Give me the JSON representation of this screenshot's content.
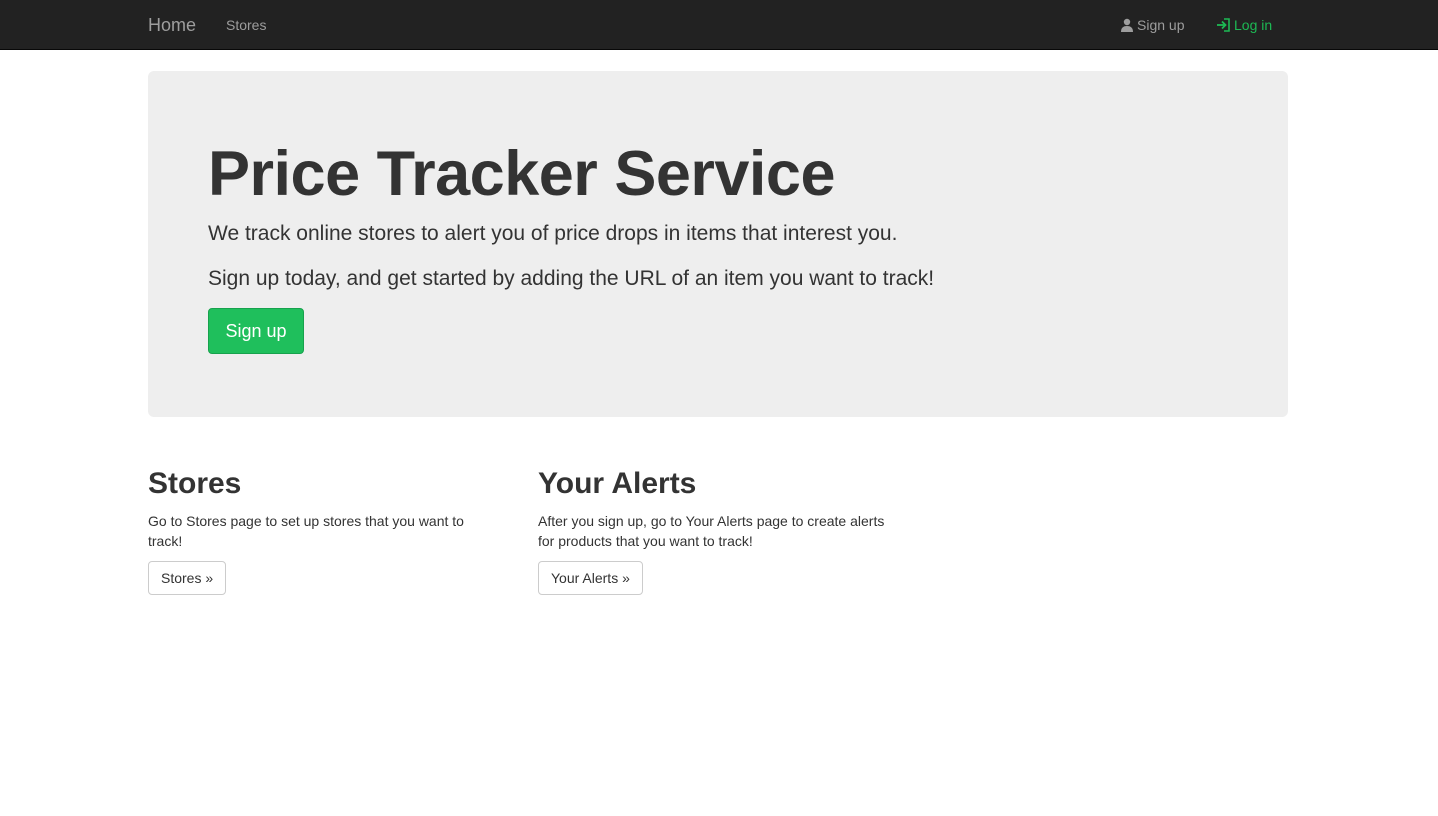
{
  "colors": {
    "navbar_bg": "#222222",
    "nav_link": "#9d9d9d",
    "accent": "#1db954",
    "primary_button": "#1fbf5c",
    "jumbotron_bg": "#eeeeee"
  },
  "navbar": {
    "brand": "Home",
    "links": [
      {
        "label": "Stores"
      }
    ],
    "right": {
      "signup": {
        "label": "Sign up",
        "icon": "user-icon"
      },
      "login": {
        "label": "Log in",
        "icon": "log-in-icon"
      }
    }
  },
  "jumbotron": {
    "title": "Price Tracker Service",
    "lead_1": "We track online stores to alert you of price drops in items that interest you.",
    "lead_2": "Sign up today, and get started by adding the URL of an item you want to track!",
    "button_label": "Sign up"
  },
  "columns": [
    {
      "heading": "Stores",
      "text": "Go to Stores page to set up stores that you want to track!",
      "button_label": "Stores »"
    },
    {
      "heading": "Your Alerts",
      "text": "After you sign up, go to Your Alerts page to create alerts for products that you want to track!",
      "button_label": "Your Alerts »"
    }
  ]
}
